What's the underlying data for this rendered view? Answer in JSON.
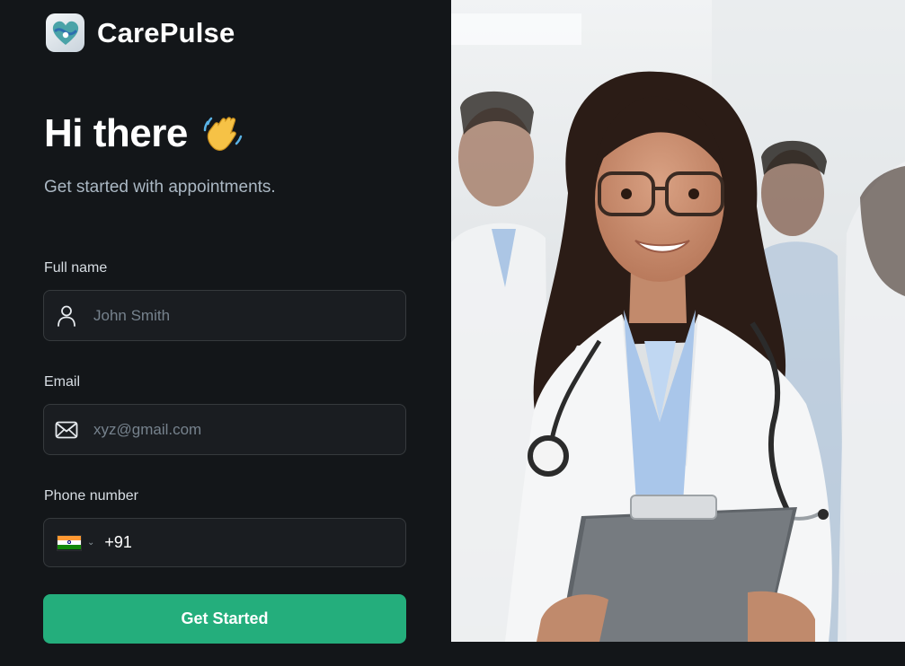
{
  "app": {
    "name": "CarePulse"
  },
  "hero": {
    "title": "Hi there",
    "subtitle": "Get started with appointments."
  },
  "form": {
    "full_name": {
      "label": "Full name",
      "placeholder": "John Smith",
      "icon": "user-icon"
    },
    "email": {
      "label": "Email",
      "placeholder": "xyz@gmail.com",
      "icon": "mail-icon"
    },
    "phone": {
      "label": "Phone number",
      "country": "India",
      "dial_code": "+91",
      "icon": "india-flag-icon"
    },
    "submit_label": "Get Started"
  },
  "colors": {
    "background": "#131619",
    "input_background": "#1a1d21",
    "accent": "#24ae7c",
    "muted_text": "#abb8c4"
  }
}
